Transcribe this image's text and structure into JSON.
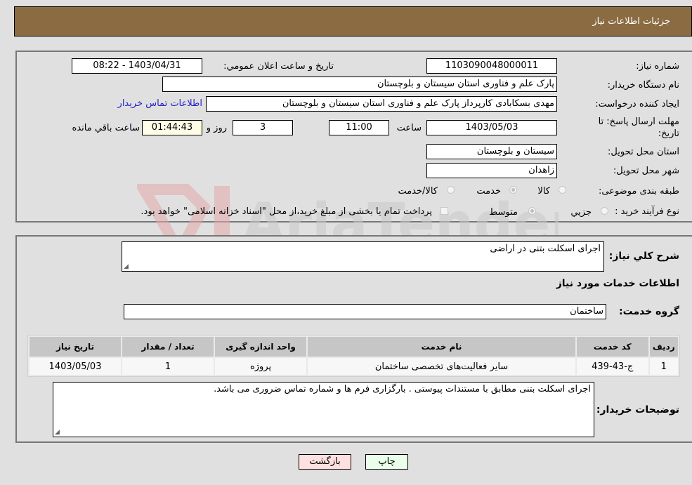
{
  "header": {
    "title": "جزئيات اطلاعات نیاز"
  },
  "form": {
    "need_number": {
      "label": "شماره نیاز:",
      "value": "1103090048000011"
    },
    "announce_datetime": {
      "label": "تاريخ و ساعت اعلان عمومي:",
      "value": "1403/04/31 - 08:22"
    },
    "buyer_org": {
      "label": "نام دستگاه خریدار:",
      "value": "پارک علم و فناوری استان سیستان و بلوچستان"
    },
    "requester": {
      "label": "ایجاد کننده درخواست:",
      "value": "مهدی بسکابادی کارپرداز پارک علم و فناوری استان سیستان و بلوچستان"
    },
    "buyer_contact_link": "اطلاعات تماس خریدار",
    "deadline": {
      "label": "مهلت ارسال پاسخ: تا تاریخ:",
      "date": "1403/05/03",
      "time_label": "ساعت",
      "time": "11:00",
      "days": "3",
      "days_label": "روز و",
      "remaining": "01:44:43",
      "remaining_label": "ساعت باقي مانده"
    },
    "province": {
      "label": "استان محل تحویل:",
      "value": "سیستان و بلوچستان"
    },
    "city": {
      "label": "شهر محل تحویل:",
      "value": "زاهدان"
    },
    "category": {
      "label": "طبقه بندی موضوعی:",
      "options": [
        {
          "label": "کالا",
          "checked": false
        },
        {
          "label": "خدمت",
          "checked": true
        },
        {
          "label": "کالا/خدمت",
          "checked": false
        }
      ]
    },
    "purchase_type": {
      "label": "نوع فرآیند خرید :",
      "options": [
        {
          "label": "جزيي",
          "checked": false
        },
        {
          "label": "متوسط",
          "checked": true
        }
      ],
      "treasury_note": "پرداخت تمام یا بخشی از مبلغ خرید،از محل \"اسناد خزانه اسلامی\" خواهد بود."
    }
  },
  "details": {
    "general_desc": {
      "label": "شرح كلي نياز:",
      "value": "اجرای اسکلت بتنی در اراضی"
    },
    "services_title": "اطلاعات خدمات مورد نیاز",
    "service_group": {
      "label": "گروه خدمت:",
      "value": "ساختمان"
    },
    "table": {
      "headers": [
        "ردیف",
        "کد خدمت",
        "نام خدمت",
        "واحد اندازه گیری",
        "تعداد / مقدار",
        "تاریخ نیاز"
      ],
      "rows": [
        [
          "1",
          "ج-43-439",
          "سایر فعالیت‌های تخصصی ساختمان",
          "پروژه",
          "1",
          "1403/05/03"
        ]
      ]
    },
    "buyer_notes": {
      "label": "توضیحات خریدار:",
      "value": "اجرای اسکلت بتنی مطابق با مستندات پیوستی . بارگزاری فرم ها و شماره تماس ضروری می باشد."
    }
  },
  "buttons": {
    "print": "چاپ",
    "back": "بازگشت"
  },
  "colors": {
    "header_bg": "#8b6c42",
    "print_bg": "#eaffea",
    "back_bg": "#ffe0e0",
    "link": "#2222cc"
  }
}
